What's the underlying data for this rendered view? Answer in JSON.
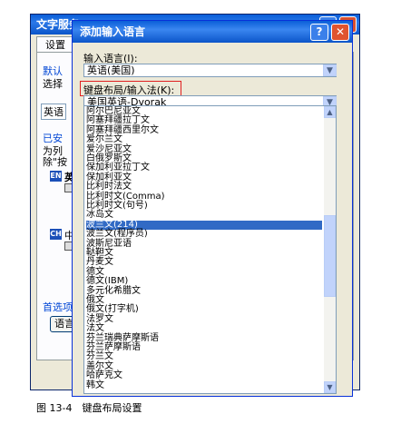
{
  "back_window": {
    "title": "文字服务",
    "tab": "设置",
    "default_group": "默认",
    "default_select": "选择",
    "default_value": "英语",
    "installed_group": "已安",
    "installed_desc_1": "为列",
    "installed_desc_2": "除\"按",
    "lang_en": "EN",
    "lang_en_text": "英",
    "lang_ch": "CH",
    "lang_ch_text": "中",
    "prefs_group": "首选项",
    "prefs_button": "语言"
  },
  "dialog": {
    "title": "添加输入语言",
    "help_glyph": "?",
    "close_glyph": "✕",
    "input_language_label": "输入语言(I):",
    "input_language_value": "英语(美国)",
    "layout_label": "键盘布局/输入法(K):",
    "layout_value": "美国英语-Dvorak"
  },
  "layout_list": [
    "阿尔巴尼亚文",
    "阿塞拜疆拉丁文",
    "阿塞拜疆西里尔文",
    "爱尔兰文",
    "爱沙尼亚文",
    "白俄罗斯文",
    "保加利亚拉丁文",
    "保加利亚文",
    "比利时法文",
    "比利时文(Comma)",
    "比利时文(句号)",
    "冰岛文",
    "波兰文(214)",
    "波兰文(程序员)",
    "波斯尼亚语",
    "鞑靼文",
    "丹麦文",
    "德文",
    "德文(IBM)",
    "多元化希腊文",
    "俄文",
    "俄文(打字机)",
    "法罗文",
    "法文",
    "芬兰瑞典萨摩斯语",
    "芬兰萨摩斯语",
    "芬兰文",
    "盖尔文",
    "哈萨克文",
    "韩文"
  ],
  "selected_index": 12,
  "caption": "图 13-4　键盘布局设置"
}
